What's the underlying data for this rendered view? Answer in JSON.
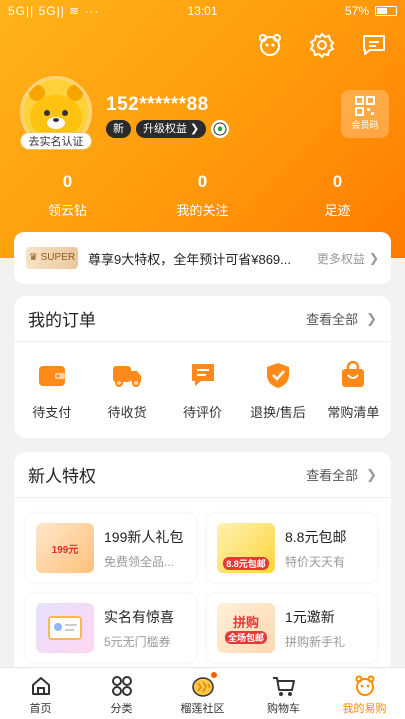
{
  "status_bar": {
    "left": "5G|| 5G|| ≋ ···",
    "time": "13:01",
    "battery": "57%"
  },
  "user": {
    "phone": "152******88",
    "verify_label": "去实名认证",
    "tag_new": "新",
    "tag_upgrade": "升级权益 ❯",
    "qr_label": "会员码"
  },
  "stats": [
    {
      "value": "0",
      "label": "领云钻"
    },
    {
      "value": "0",
      "label": "我的关注"
    },
    {
      "value": "0",
      "label": "足迹"
    }
  ],
  "super": {
    "badge": "SUPER",
    "text": "尊享9大特权，全年预计可省¥869...",
    "more": "更多权益"
  },
  "orders": {
    "title": "我的订单",
    "more": "查看全部",
    "items": [
      "待支付",
      "待收货",
      "待评价",
      "退换/售后",
      "常购清单"
    ]
  },
  "perks": {
    "title": "新人特权",
    "more": "查看全部",
    "items": [
      {
        "title": "199新人礼包",
        "sub": "免费领全品...",
        "badge": "199元"
      },
      {
        "title": "8.8元包邮",
        "sub": "特价天天有",
        "badge": "8.8元包邮"
      },
      {
        "title": "实名有惊喜",
        "sub": "5元无门槛券",
        "badge": ""
      },
      {
        "title": "1元邀新",
        "sub": "拼购新手礼",
        "badge": "全场包邮"
      }
    ]
  },
  "tabs": [
    "首页",
    "分类",
    "榴莲社区",
    "购物车",
    "我的易购"
  ],
  "colors": {
    "accent": "#ff8a00",
    "header_start": "#ffb31a",
    "header_end": "#ff7a00"
  }
}
